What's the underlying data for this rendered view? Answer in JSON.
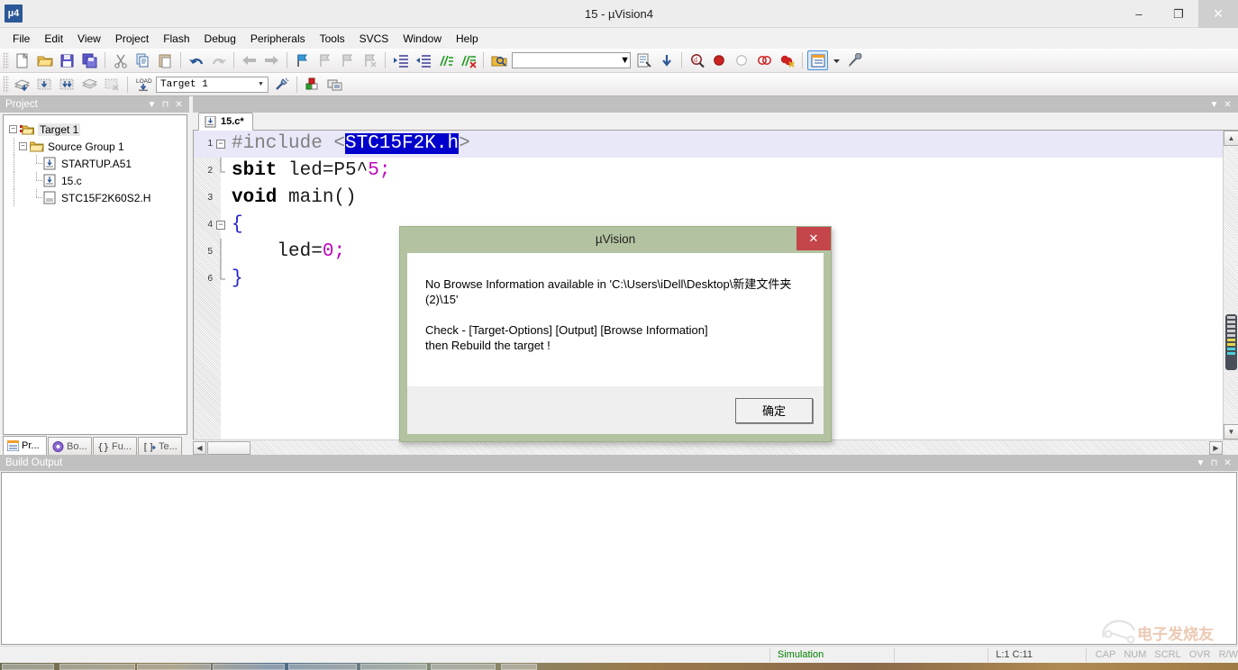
{
  "window": {
    "title": "15  - µVision4",
    "app_icon_label": "µ4",
    "minimize": "–",
    "restore": "❐",
    "close": "✕"
  },
  "menubar": {
    "items": [
      {
        "label": "File"
      },
      {
        "label": "Edit"
      },
      {
        "label": "View"
      },
      {
        "label": "Project"
      },
      {
        "label": "Flash"
      },
      {
        "label": "Debug"
      },
      {
        "label": "Peripherals"
      },
      {
        "label": "Tools"
      },
      {
        "label": "SVCS"
      },
      {
        "label": "Window"
      },
      {
        "label": "Help"
      }
    ]
  },
  "toolbar_main": {
    "icons": [
      "new-file-icon",
      "open-file-icon",
      "save-icon",
      "save-all-icon",
      "cut-icon",
      "copy-icon",
      "paste-icon",
      "undo-icon",
      "redo-icon",
      "navigate-back-icon",
      "navigate-forward-icon",
      "bookmark-toggle-icon",
      "bookmark-prev-icon",
      "bookmark-next-icon",
      "bookmark-clear-icon",
      "indent-icon",
      "outdent-icon",
      "comment-icon",
      "uncomment-icon",
      "find-in-files-icon"
    ],
    "search_value": "",
    "search_placeholder": "",
    "right_icons": [
      "browse-symbol-icon",
      "goto-definition-icon",
      "find-icon",
      "breakpoint-insert-icon",
      "breakpoint-disable-icon",
      "breakpoint-disable-all-icon",
      "breakpoint-kill-all-icon",
      "project-window-icon",
      "configure-icon"
    ]
  },
  "toolbar_build": {
    "icons": [
      "translate-icon",
      "build-icon",
      "rebuild-icon",
      "batch-build-icon",
      "stop-build-icon",
      "download-icon"
    ],
    "target_value": "Target 1",
    "target_options": [
      "Target 1"
    ],
    "right_icons": [
      "options-target-icon",
      "manage-components-icon",
      "multi-project-icon"
    ]
  },
  "project_panel": {
    "title": "Project",
    "controls": [
      "menu-chevron",
      "pin",
      "close"
    ],
    "tree": [
      {
        "label": "Target 1",
        "level": 0,
        "icon": "target-icon",
        "expander": "−",
        "selected": true
      },
      {
        "label": "Source Group 1",
        "level": 1,
        "icon": "folder-icon",
        "expander": "−",
        "selected": false
      },
      {
        "label": "STARTUP.A51",
        "level": 2,
        "icon": "asm-file-icon",
        "expander": "",
        "selected": false
      },
      {
        "label": "15.c",
        "level": 2,
        "icon": "c-file-icon",
        "expander": "",
        "selected": false
      },
      {
        "label": "STC15F2K60S2.H",
        "level": 2,
        "icon": "header-file-icon",
        "expander": "",
        "selected": false
      }
    ],
    "tabs": [
      {
        "label": "Pr...",
        "icon": "project-icon",
        "active": true
      },
      {
        "label": "Bo...",
        "icon": "books-icon",
        "active": false
      },
      {
        "label": "Fu...",
        "icon": "functions-icon",
        "active": false
      },
      {
        "label": "Te...",
        "icon": "templates-icon",
        "active": false
      }
    ]
  },
  "editor": {
    "controls": [
      "menu-chevron",
      "close"
    ],
    "tab": {
      "label": "15.c*",
      "icon": "c-file-icon"
    },
    "lines": [
      {
        "num": "1",
        "fold": "−",
        "highlighted": true,
        "tokens": [
          {
            "text": "#include ",
            "style": "pre"
          },
          {
            "text": "<",
            "style": "angle"
          },
          {
            "text": "STC15F2K.h",
            "style": "selected"
          },
          {
            "text": ">",
            "style": "angle"
          }
        ]
      },
      {
        "num": "2",
        "fold": "",
        "highlighted": false,
        "tokens": [
          {
            "text": "sbit",
            "style": "kw"
          },
          {
            "text": " led=P5^",
            "style": "plain"
          },
          {
            "text": "5",
            "style": "num"
          },
          {
            "text": ";",
            "style": "num"
          }
        ]
      },
      {
        "num": "3",
        "fold": "",
        "highlighted": false,
        "tokens": [
          {
            "text": "void",
            "style": "kw"
          },
          {
            "text": " main()",
            "style": "plain"
          }
        ]
      },
      {
        "num": "4",
        "fold": "−",
        "highlighted": false,
        "tokens": [
          {
            "text": "{",
            "style": "brace"
          }
        ]
      },
      {
        "num": "5",
        "fold": "",
        "highlighted": false,
        "tokens": [
          {
            "text": "    led=",
            "style": "plain"
          },
          {
            "text": "0",
            "style": "num"
          },
          {
            "text": ";",
            "style": "num"
          }
        ]
      },
      {
        "num": "6",
        "fold": "",
        "highlighted": false,
        "tokens": [
          {
            "text": "}",
            "style": "brace"
          }
        ]
      }
    ]
  },
  "build_output": {
    "title": "Build Output",
    "controls": [
      "menu-chevron",
      "pin",
      "close"
    ],
    "content": ""
  },
  "status_bar": {
    "simulation": "Simulation",
    "position": "L:1 C:11",
    "flags": [
      "CAP",
      "NUM",
      "SCRL",
      "OVR",
      "R/W"
    ]
  },
  "dialog": {
    "title": "µVision",
    "close_label": "✕",
    "message_line1": "No Browse Information available in 'C:\\Users\\iDell\\Desktop\\新建文件夹",
    "message_line2": "(2)\\15'",
    "message_line3": "Check - [Target-Options] [Output] [Browse Information]",
    "message_line4": "then Rebuild the target !",
    "ok_label": "确定"
  },
  "watermark": {
    "text": "电子发烧友"
  },
  "colors": {
    "dialog_frame": "#b3c2a0",
    "dialog_close": "#c4454a",
    "selection_blue": "#0000cc",
    "simulation_green": "#008000",
    "panel_header": "#c0c0c0",
    "keyword": "#000000",
    "number": "#c000c0",
    "brace": "#2222cc",
    "preprocessor": "#808080"
  }
}
